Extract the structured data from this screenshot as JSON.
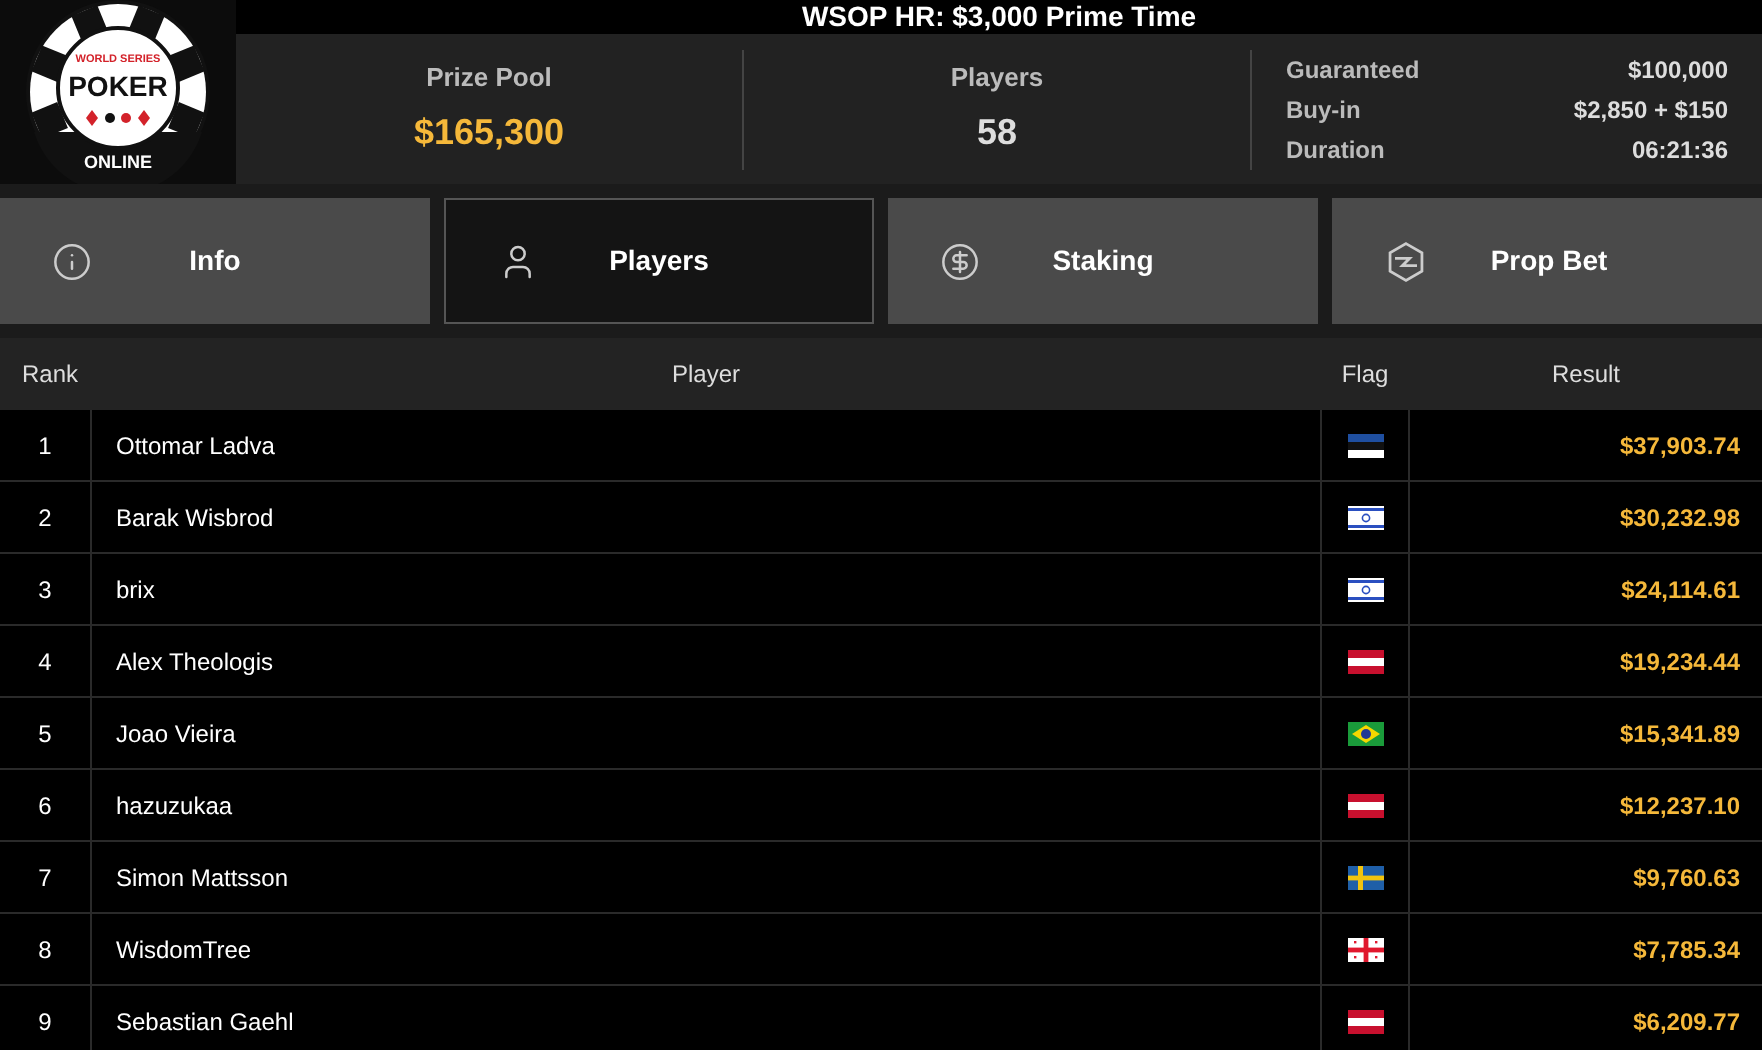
{
  "logo": {
    "top": "WORLD SERIES",
    "middle": "POKER",
    "bottom": "ONLINE"
  },
  "title": "WSOP HR: $3,000 Prime Time",
  "stats": [
    {
      "label": "Prize Pool",
      "value": "$165,300",
      "highlight": true
    },
    {
      "label": "Players",
      "value": "58",
      "highlight": false
    }
  ],
  "details": [
    {
      "label": "Guaranteed",
      "value": "$100,000"
    },
    {
      "label": "Buy-in",
      "value": "$2,850 + $150"
    },
    {
      "label": "Duration",
      "value": "06:21:36"
    }
  ],
  "tabs": [
    {
      "label": "Info",
      "selected": false
    },
    {
      "label": "Players",
      "selected": true
    },
    {
      "label": "Staking",
      "selected": false
    },
    {
      "label": "Prop Bet",
      "selected": false
    }
  ],
  "table": {
    "columns": [
      "Rank",
      "Player",
      "Flag",
      "Result"
    ],
    "rows": [
      {
        "rank": "1",
        "player": "Ottomar Ladva",
        "flag": {
          "kind": "estonia"
        },
        "result": "$37,903.74"
      },
      {
        "rank": "2",
        "player": "Barak Wisbrod",
        "flag": {
          "kind": "israel"
        },
        "result": "$30,232.98"
      },
      {
        "rank": "3",
        "player": "brix",
        "flag": {
          "kind": "israel"
        },
        "result": "$24,114.61"
      },
      {
        "rank": "4",
        "player": "Alex Theologis",
        "flag": {
          "kind": "austria"
        },
        "result": "$19,234.44"
      },
      {
        "rank": "5",
        "player": "Joao Vieira",
        "flag": {
          "kind": "brazil"
        },
        "result": "$15,341.89"
      },
      {
        "rank": "6",
        "player": "hazuzukaa",
        "flag": {
          "kind": "austria"
        },
        "result": "$12,237.10"
      },
      {
        "rank": "7",
        "player": "Simon Mattsson",
        "flag": {
          "kind": "sweden"
        },
        "result": "$9,760.63"
      },
      {
        "rank": "8",
        "player": "WisdomTree",
        "flag": {
          "kind": "georgia"
        },
        "result": "$7,785.34"
      },
      {
        "rank": "9",
        "player": "Sebastian Gaehl",
        "flag": {
          "kind": "austria"
        },
        "result": "$6,209.77"
      }
    ]
  }
}
